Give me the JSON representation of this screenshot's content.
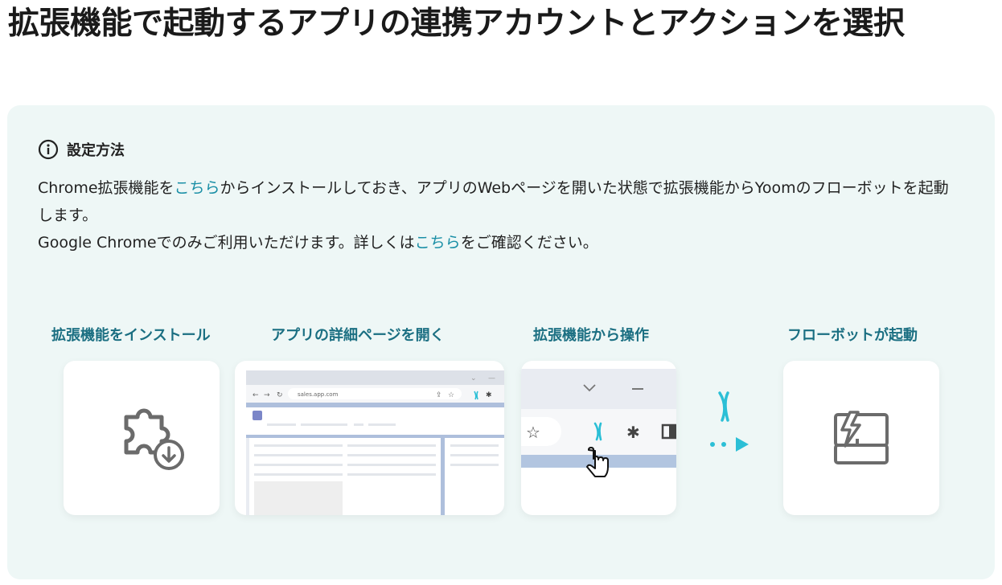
{
  "title": "拡張機能で起動するアプリの連携アカウントとアクションを選択",
  "section": {
    "heading": "設定方法",
    "line1_a": "Chrome拡張機能を",
    "line1_link": "こちら",
    "line1_b": "からインストールしておき、アプリのWebページを開いた状態で拡張機能からYoomのフローボットを起動します。",
    "line2_a": "Google Chromeでのみご利用いただけます。詳しくは",
    "line2_link": "こちら",
    "line2_b": "をご確認ください。"
  },
  "steps": [
    {
      "label": "拡張機能をインストール",
      "icon": "puzzle-download-icon"
    },
    {
      "label": "アプリの詳細ページを開く",
      "icon": "browser-page-illustration"
    },
    {
      "label": "拡張機能から操作",
      "icon": "extension-toolbar-illustration"
    },
    {
      "label": "フローボットが起動",
      "icon": "flowbot-launch-icon"
    }
  ],
  "browser": {
    "url": "sales.app.com"
  },
  "colors": {
    "accent": "#1a8fa6",
    "step_label": "#1b6f82",
    "panel_bg": "#eef7f6",
    "yoom": "#2bbfd6"
  }
}
